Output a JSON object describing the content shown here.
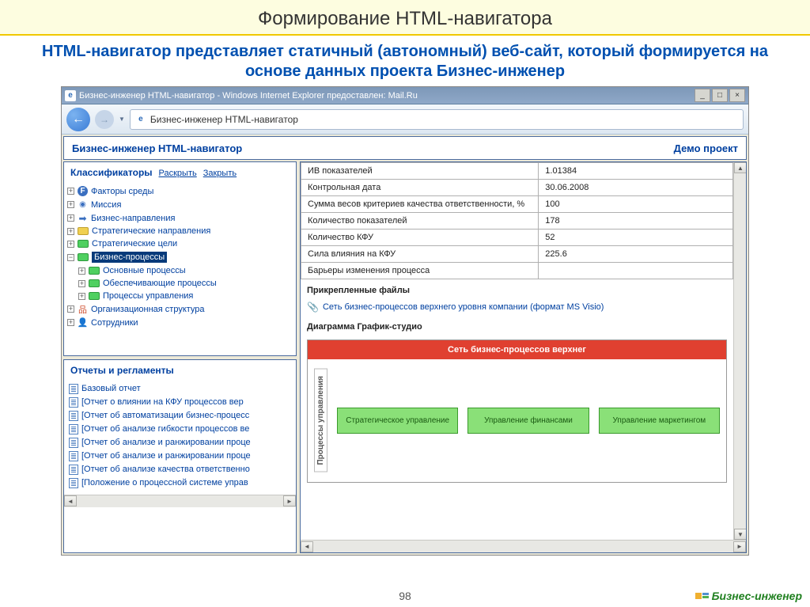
{
  "slide": {
    "title": "Формирование HTML-навигатора",
    "subtitle": "HTML-навигатор представляет статичный (автономный) веб-сайт, который формируется на основе данных проекта Бизнес-инженер",
    "page_number": "98",
    "brand": "Бизнес-инженер"
  },
  "window": {
    "title": "Бизнес-инженер HTML-навигатор - Windows Internet Explorer предоставлен: Mail.Ru",
    "tab_title": "Бизнес-инженер HTML-навигатор"
  },
  "header": {
    "title": "Бизнес-инженер HTML-навигатор",
    "project": "Демо проект"
  },
  "classifiers": {
    "title": "Классификаторы",
    "expand": "Раскрыть",
    "collapse": "Закрыть",
    "items": [
      "Факторы среды",
      "Миссия",
      "Бизнес-направления",
      "Стратегические направления",
      "Стратегические цели",
      "Бизнес-процессы",
      "Основные процессы",
      "Обеспечивающие процессы",
      "Процессы управления",
      "Организационная структура",
      "Сотрудники"
    ]
  },
  "reports": {
    "title": "Отчеты и регламенты",
    "items": [
      "Базовый отчет",
      "[Отчет о влиянии на КФУ процессов вер",
      "[Отчет об автоматизации бизнес-процесс",
      "[Отчет об анализе гибкости процессов ве",
      "[Отчет об анализе и ранжировании проце",
      "[Отчет об анализе и ранжировании проце",
      "[Отчет об анализе качества ответственно",
      "[Положение о процессной системе управ"
    ]
  },
  "table": {
    "rows": [
      {
        "k": "ИВ показателей",
        "v": "1.01384"
      },
      {
        "k": "Контрольная дата",
        "v": "30.06.2008"
      },
      {
        "k": "Сумма весов критериев качества ответственности, %",
        "v": "100"
      },
      {
        "k": "Количество показателей",
        "v": "178"
      },
      {
        "k": "Количество КФУ",
        "v": "52"
      },
      {
        "k": "Сила влияния на КФУ",
        "v": "225.6"
      },
      {
        "k": "Барьеры изменения процесса",
        "v": ""
      }
    ]
  },
  "attachments": {
    "title": "Прикрепленные файлы",
    "file": "Сеть бизнес-процессов верхнего уровня компании (формат  MS Visio)"
  },
  "diagram": {
    "title": "Диаграмма График-студио",
    "header": "Сеть бизнес-процессов верхнег",
    "side_label": "Процессы управления",
    "boxes": [
      "Стратегическое управление",
      "Управление финансами",
      "Управление маркетингом"
    ]
  }
}
